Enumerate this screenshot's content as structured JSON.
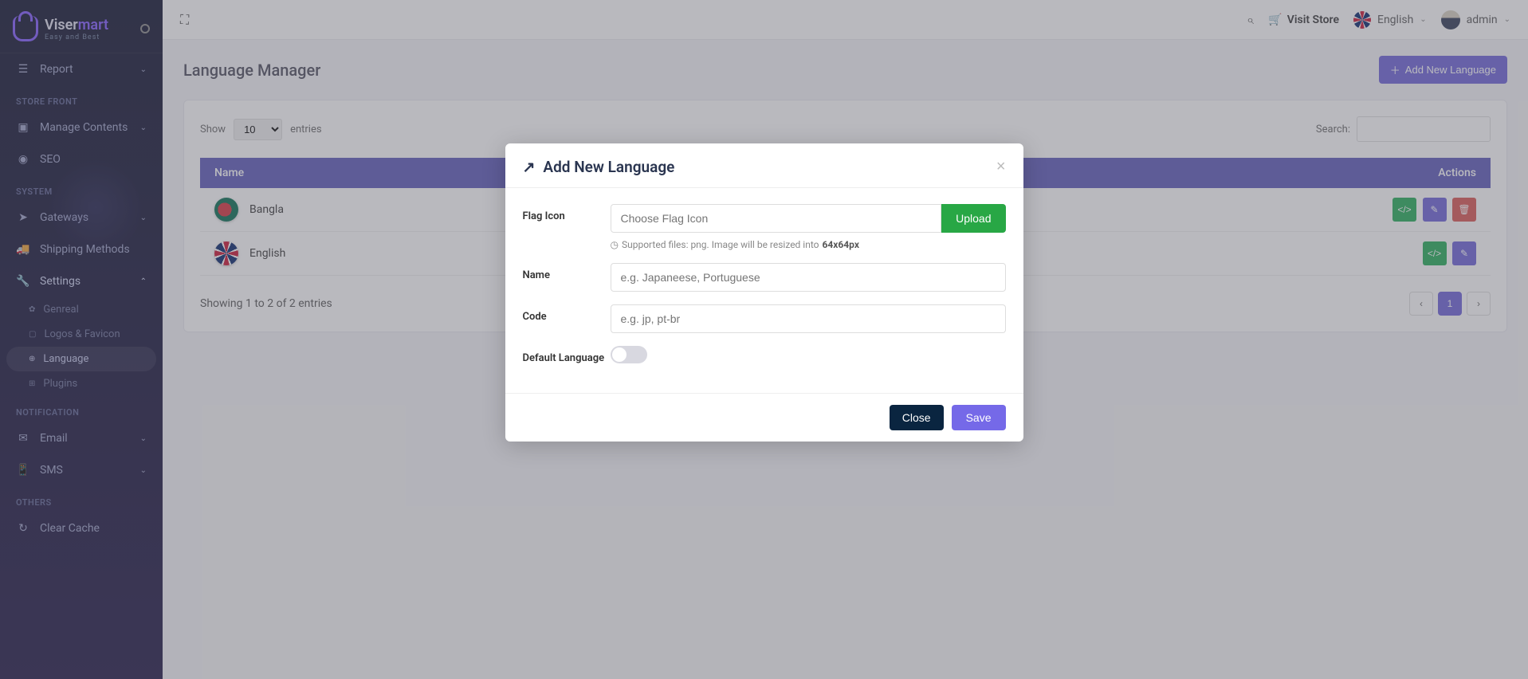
{
  "brand": {
    "name1": "Viser",
    "name2": "mart",
    "tagline": "Easy and Best"
  },
  "topbar": {
    "visit_store": "Visit Store",
    "language": "English",
    "user": "admin"
  },
  "sidebar": {
    "report": "Report",
    "sections": {
      "store_front": "STORE FRONT",
      "system": "SYSTEM",
      "notification": "NOTIFICATION",
      "others": "OTHERS"
    },
    "items": {
      "manage_contents": "Manage Contents",
      "seo": "SEO",
      "gateways": "Gateways",
      "shipping": "Shipping Methods",
      "settings": "Settings",
      "email": "Email",
      "sms": "SMS",
      "clear_cache": "Clear Cache"
    },
    "settings_sub": {
      "general": "Genreal",
      "logos": "Logos & Favicon",
      "language": "Language",
      "plugins": "Plugins"
    }
  },
  "page": {
    "title": "Language Manager",
    "add_btn": "Add New Language"
  },
  "table": {
    "show": "Show",
    "entries": "entries",
    "entries_value": "10",
    "search_label": "Search:",
    "col_name": "Name",
    "col_actions": "Actions",
    "rows": [
      {
        "name": "Bangla"
      },
      {
        "name": "English"
      }
    ],
    "footer": "Showing 1 to 2 of 2 entries",
    "page": "1"
  },
  "modal": {
    "title": "Add New Language",
    "labels": {
      "flag": "Flag Icon",
      "name": "Name",
      "code": "Code",
      "default": "Default Language"
    },
    "placeholders": {
      "flag": "Choose Flag Icon",
      "name": "e.g. Japaneese, Portuguese",
      "code": "e.g. jp, pt-br"
    },
    "upload": "Upload",
    "help_prefix": "Supported files: png. Image will be resized into ",
    "help_size": "64x64px",
    "close": "Close",
    "save": "Save"
  }
}
